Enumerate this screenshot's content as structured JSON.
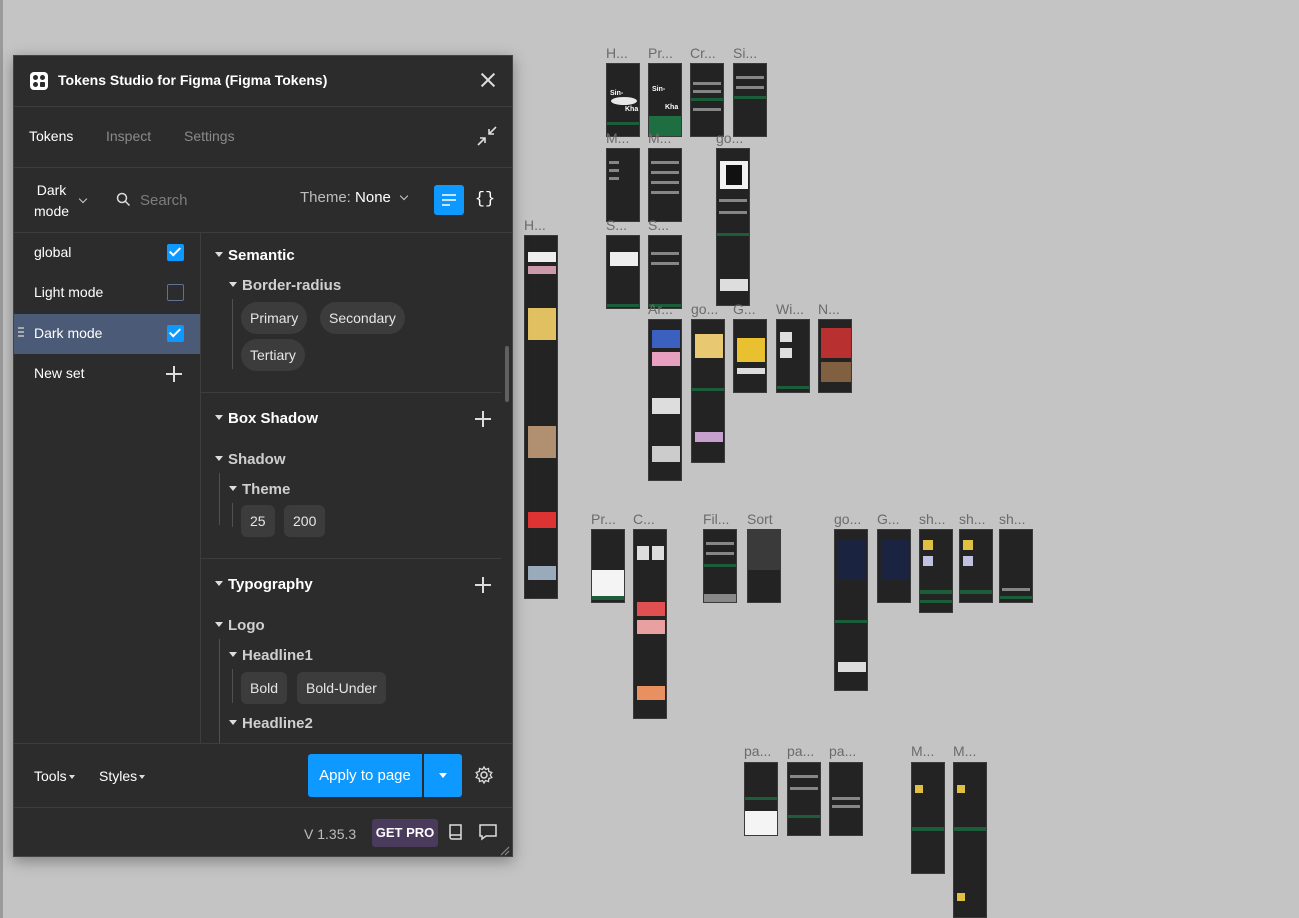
{
  "canvas": {
    "frame_labels": [
      "H...",
      "Pr...",
      "Cr...",
      "Si...",
      "M...",
      "M...",
      "go...",
      "H...",
      "S...",
      "S...",
      "Ar...",
      "go...",
      "G...",
      "Wi...",
      "N...",
      "Pr...",
      "C...",
      "Fil...",
      "Sort",
      "go...",
      "G...",
      "sh...",
      "sh...",
      "sh...",
      "pa...",
      "pa...",
      "pa...",
      "M...",
      "M..."
    ],
    "frame_thumb_text": [
      "Sin-",
      "Kha",
      "Sin-",
      "Kha"
    ]
  },
  "plugin": {
    "title": "Tokens Studio for Figma (Figma Tokens)",
    "tabs": [
      "Tokens",
      "Inspect",
      "Settings"
    ],
    "active_tab": "Tokens",
    "mode_selector": {
      "line1": "Dark",
      "line2": "mode"
    },
    "search": {
      "placeholder": "Search",
      "value": ""
    },
    "theme": {
      "label": "Theme:",
      "value": "None"
    },
    "json_view_label": "{}",
    "token_sets": [
      {
        "label": "global",
        "checked": true
      },
      {
        "label": "Light mode",
        "checked": false
      },
      {
        "label": "Dark mode",
        "checked": true,
        "active": true
      }
    ],
    "new_set_label": "New set",
    "groups": {
      "semantic": {
        "title": "Semantic",
        "border_radius": {
          "title": "Border-radius",
          "tokens": [
            "Primary",
            "Secondary",
            "Tertiary"
          ]
        }
      },
      "box_shadow": {
        "title": "Box Shadow",
        "shadow": {
          "title": "Shadow",
          "theme": {
            "title": "Theme",
            "tokens": [
              "25",
              "200"
            ]
          }
        }
      },
      "typography": {
        "title": "Typography",
        "logo": {
          "title": "Logo",
          "headline1": {
            "title": "Headline1",
            "tokens": [
              "Bold",
              "Bold-Under"
            ]
          },
          "headline2": {
            "title": "Headline2"
          }
        }
      }
    },
    "footer": {
      "tools_label": "Tools",
      "styles_label": "Styles",
      "apply_label": "Apply to page"
    },
    "bottom": {
      "version": "V 1.35.3",
      "get_pro_label": "GET PRO"
    },
    "colors": {
      "accent": "#0d99ff",
      "panel_bg": "#2c2c2c",
      "active_set_bg": "#4b5a76",
      "pro_bg": "#4a3a5c"
    }
  }
}
